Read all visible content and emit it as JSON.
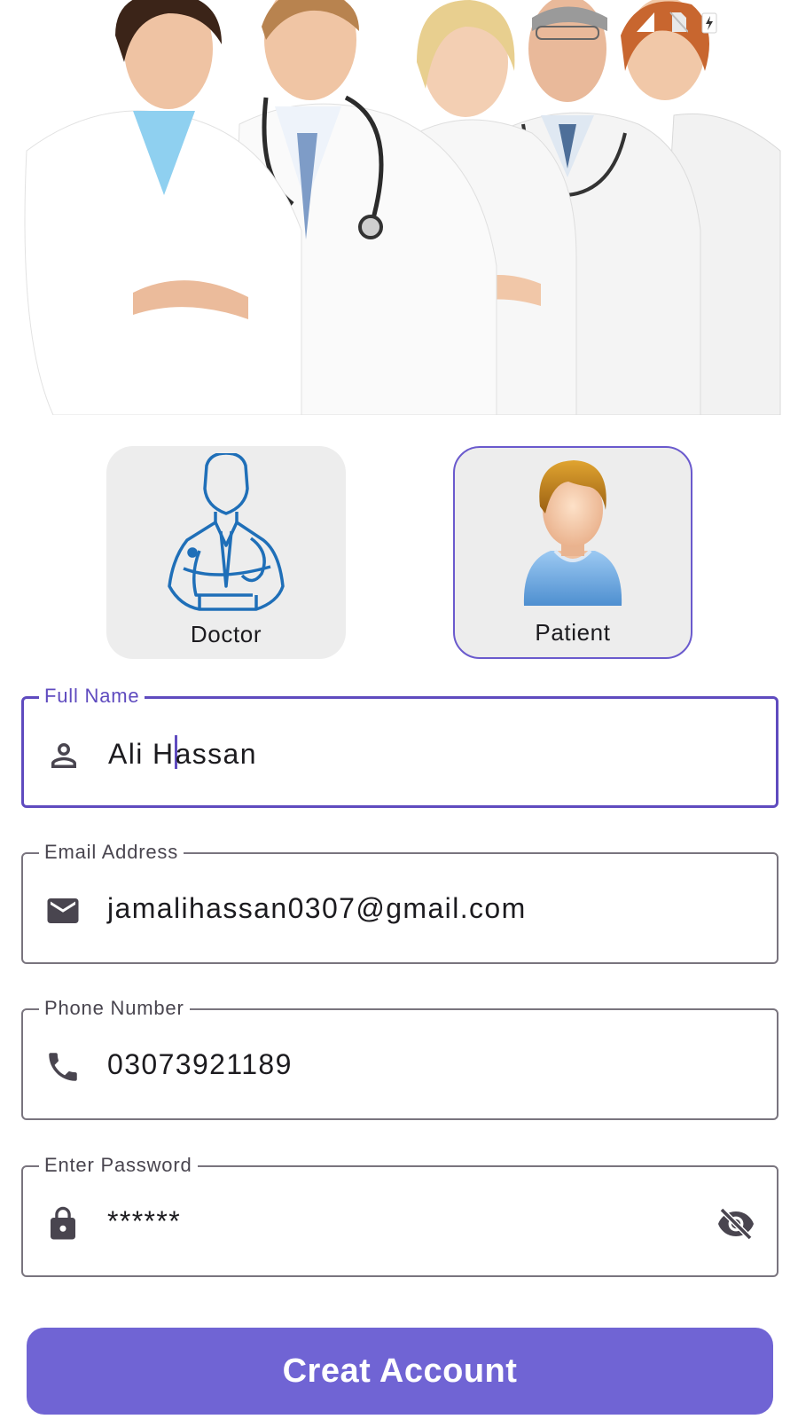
{
  "roles": [
    {
      "label": "Doctor",
      "icon": "doctor-icon",
      "selected": false
    },
    {
      "label": "Patient",
      "icon": "patient-avatar-icon",
      "selected": true
    }
  ],
  "form": {
    "full_name": {
      "label": "Full Name",
      "value_before_caret": "Ali H",
      "value_after_caret": "assan",
      "icon": "person-icon"
    },
    "email": {
      "label": "Email Address",
      "value": "jamalihassan0307@gmail.com",
      "icon": "mail-icon"
    },
    "phone": {
      "label": "Phone Number",
      "value": "03073921189",
      "icon": "phone-icon"
    },
    "password": {
      "label": "Enter Password",
      "value": "******",
      "icon": "lock-icon",
      "toggle_icon": "visibility-off-icon"
    }
  },
  "submit": {
    "label": "Creat Account"
  },
  "colors": {
    "accent": "#5f4bbf",
    "button": "#7064d4",
    "card": "#ededed",
    "outline": "#79747e"
  }
}
